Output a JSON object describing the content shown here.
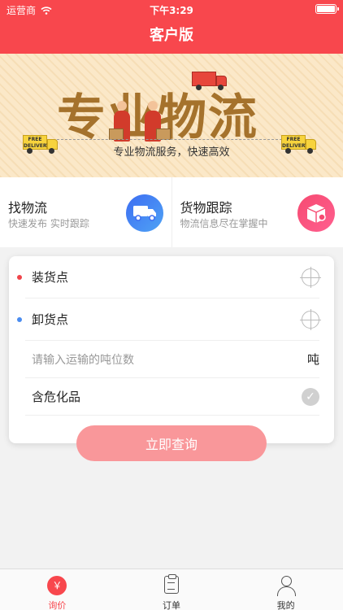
{
  "status_bar": {
    "carrier": "运营商",
    "time": "下午3:29",
    "wifi_icon": "wifi-icon",
    "battery_icon": "battery-icon"
  },
  "nav": {
    "title": "客户版"
  },
  "banner": {
    "headline": "专业物流",
    "subtitle": "专业物流服务，快速高效",
    "truck_label": "FREE DELIVERY"
  },
  "services": [
    {
      "title": "找物流",
      "desc": "快速发布  实时跟踪",
      "icon": "truck-icon"
    },
    {
      "title": "货物跟踪",
      "desc": "物流信息尽在掌握中",
      "icon": "package-icon"
    }
  ],
  "form": {
    "loading_point": "装货点",
    "unloading_point": "卸货点",
    "tonnage_placeholder": "请输入运输的吨位数",
    "tonnage_unit": "吨",
    "hazardous": "含危化品"
  },
  "query_button": "立即查询",
  "tabs": [
    {
      "label": "询价",
      "icon": "yuan-icon",
      "active": true
    },
    {
      "label": "订单",
      "icon": "clipboard-icon",
      "active": false
    },
    {
      "label": "我的",
      "icon": "user-icon",
      "active": false
    }
  ],
  "colors": {
    "brand": "#f8474d",
    "button": "#f9979a"
  }
}
